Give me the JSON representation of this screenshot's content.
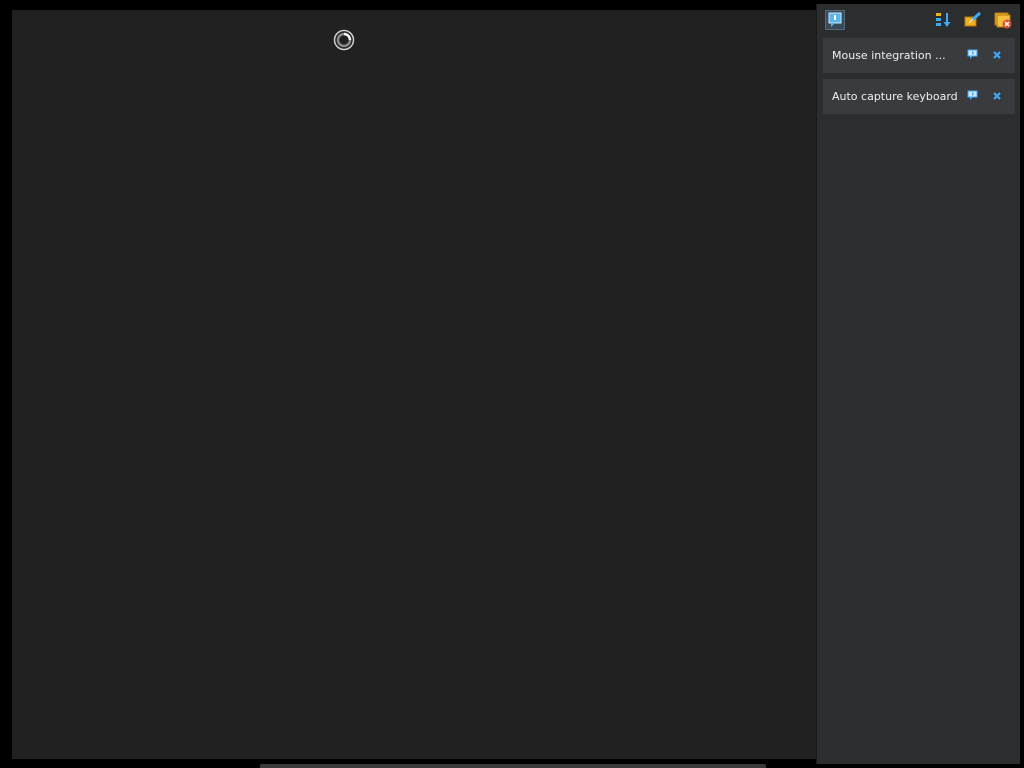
{
  "screen": {
    "icons": {
      "busy": "busy-spinner-icon"
    }
  },
  "notification_panel": {
    "toolbar": {
      "toggle_icon": "notification-center-icon",
      "sort_icon": "sort-order-icon",
      "clear_icon": "clear-notifications-icon",
      "close_all_icon": "close-all-icon"
    },
    "items": [
      {
        "text": "Mouse integration ...",
        "help_icon": "help-icon",
        "close_icon": "close-icon"
      },
      {
        "text": "Auto capture keyboard ...",
        "help_icon": "help-icon",
        "close_icon": "close-icon"
      }
    ]
  },
  "colors": {
    "screen_bg": "#212121",
    "panel_bg": "#2c2d2f",
    "item_bg": "#3a3b3e",
    "accent": "#3fa9f5",
    "warning": "#f0b020",
    "danger": "#e05030"
  }
}
